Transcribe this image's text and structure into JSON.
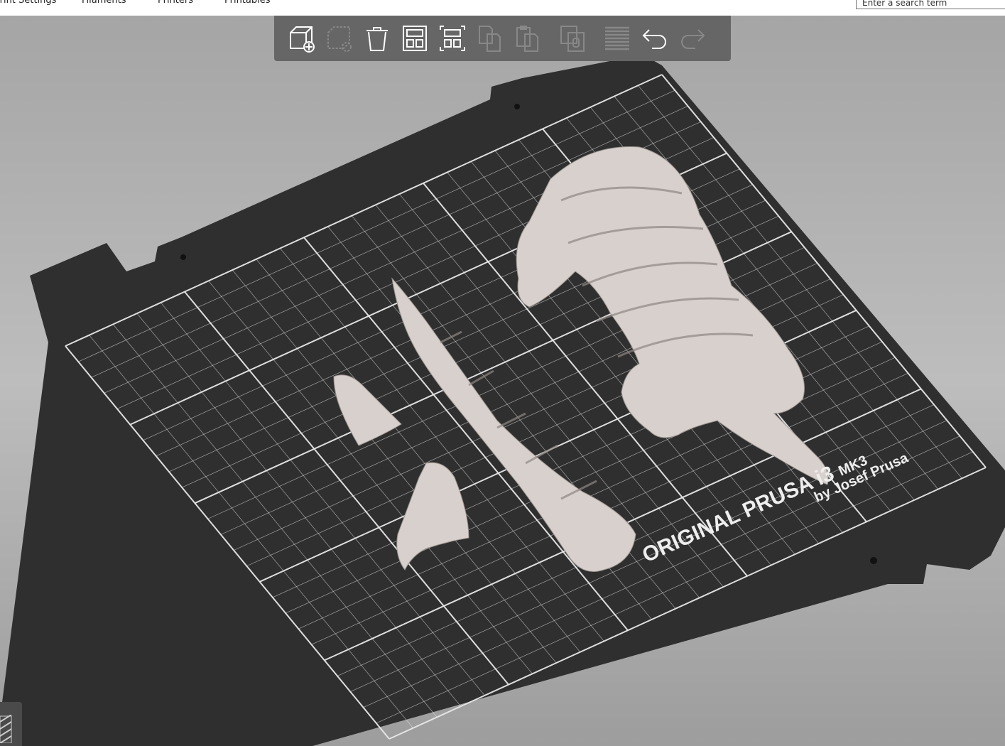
{
  "tabs": [
    {
      "label": "Print Settings"
    },
    {
      "label": "Filaments"
    },
    {
      "label": "Printers"
    },
    {
      "label": "Printables"
    }
  ],
  "search": {
    "placeholder": "Enter a search term"
  },
  "toolbar": [
    "add",
    "delete",
    "delete-all",
    "arrange",
    "arrange-selection",
    "copy",
    "paste",
    "add-instance",
    "layers-editing",
    "undo",
    "redo"
  ],
  "bed": {
    "brand_line1": "ORIGINAL PRUSA i3",
    "brand_mk": "MK3",
    "brand_line2": "by Josef Prusa"
  },
  "colors": {
    "bed": "#2f2f2f",
    "grid": "#e8e8e8",
    "model": "#d8d0cc",
    "toolbar": "#666666"
  }
}
